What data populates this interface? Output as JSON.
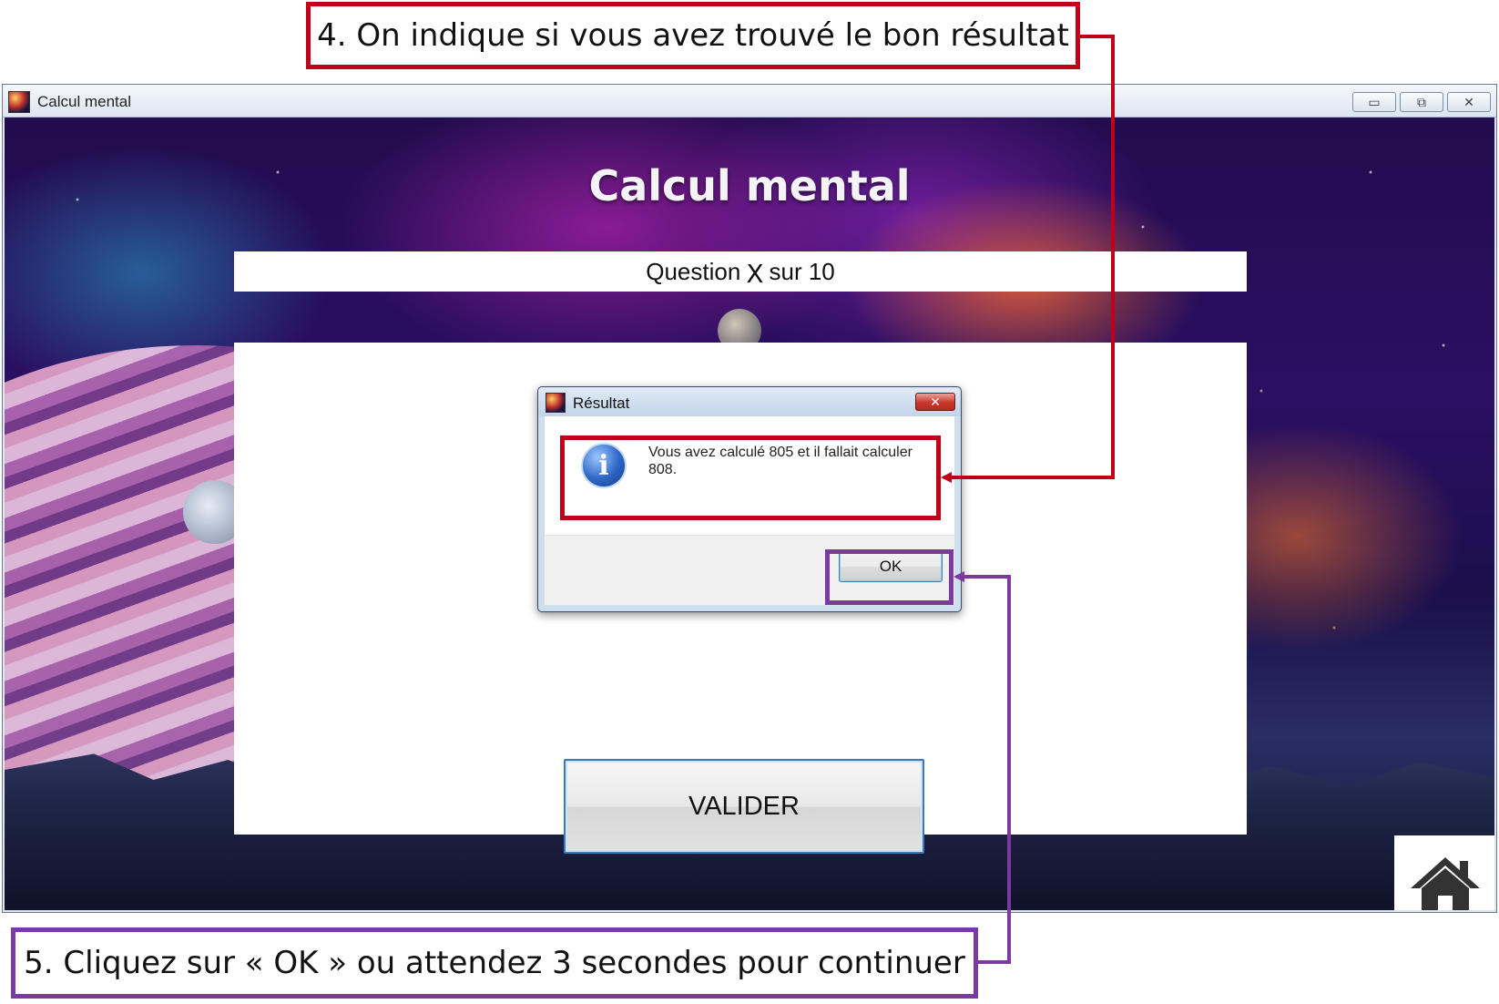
{
  "annotations": {
    "step4": "4. On indique si vous avez trouvé le bon résultat",
    "step5": "5. Cliquez sur « OK » ou attendez 3 secondes pour continuer",
    "colors": {
      "step4": "#c00018",
      "step5": "#7a3aa0"
    }
  },
  "window": {
    "title": "Calcul mental",
    "controls": {
      "minimize": "▭",
      "restore": "⧉",
      "close": "✕"
    }
  },
  "app": {
    "heading": "Calcul mental",
    "question": {
      "prefix": "Question",
      "number": "X",
      "suffix": "sur 10"
    },
    "validate_label": "VALIDER",
    "home_icon": "home-icon"
  },
  "dialog": {
    "title": "Résultat",
    "close_glyph": "✕",
    "icon": "info-icon",
    "icon_glyph": "i",
    "message": "Vous avez calculé 805 et il fallait calculer 808.",
    "ok_label": "OK"
  }
}
